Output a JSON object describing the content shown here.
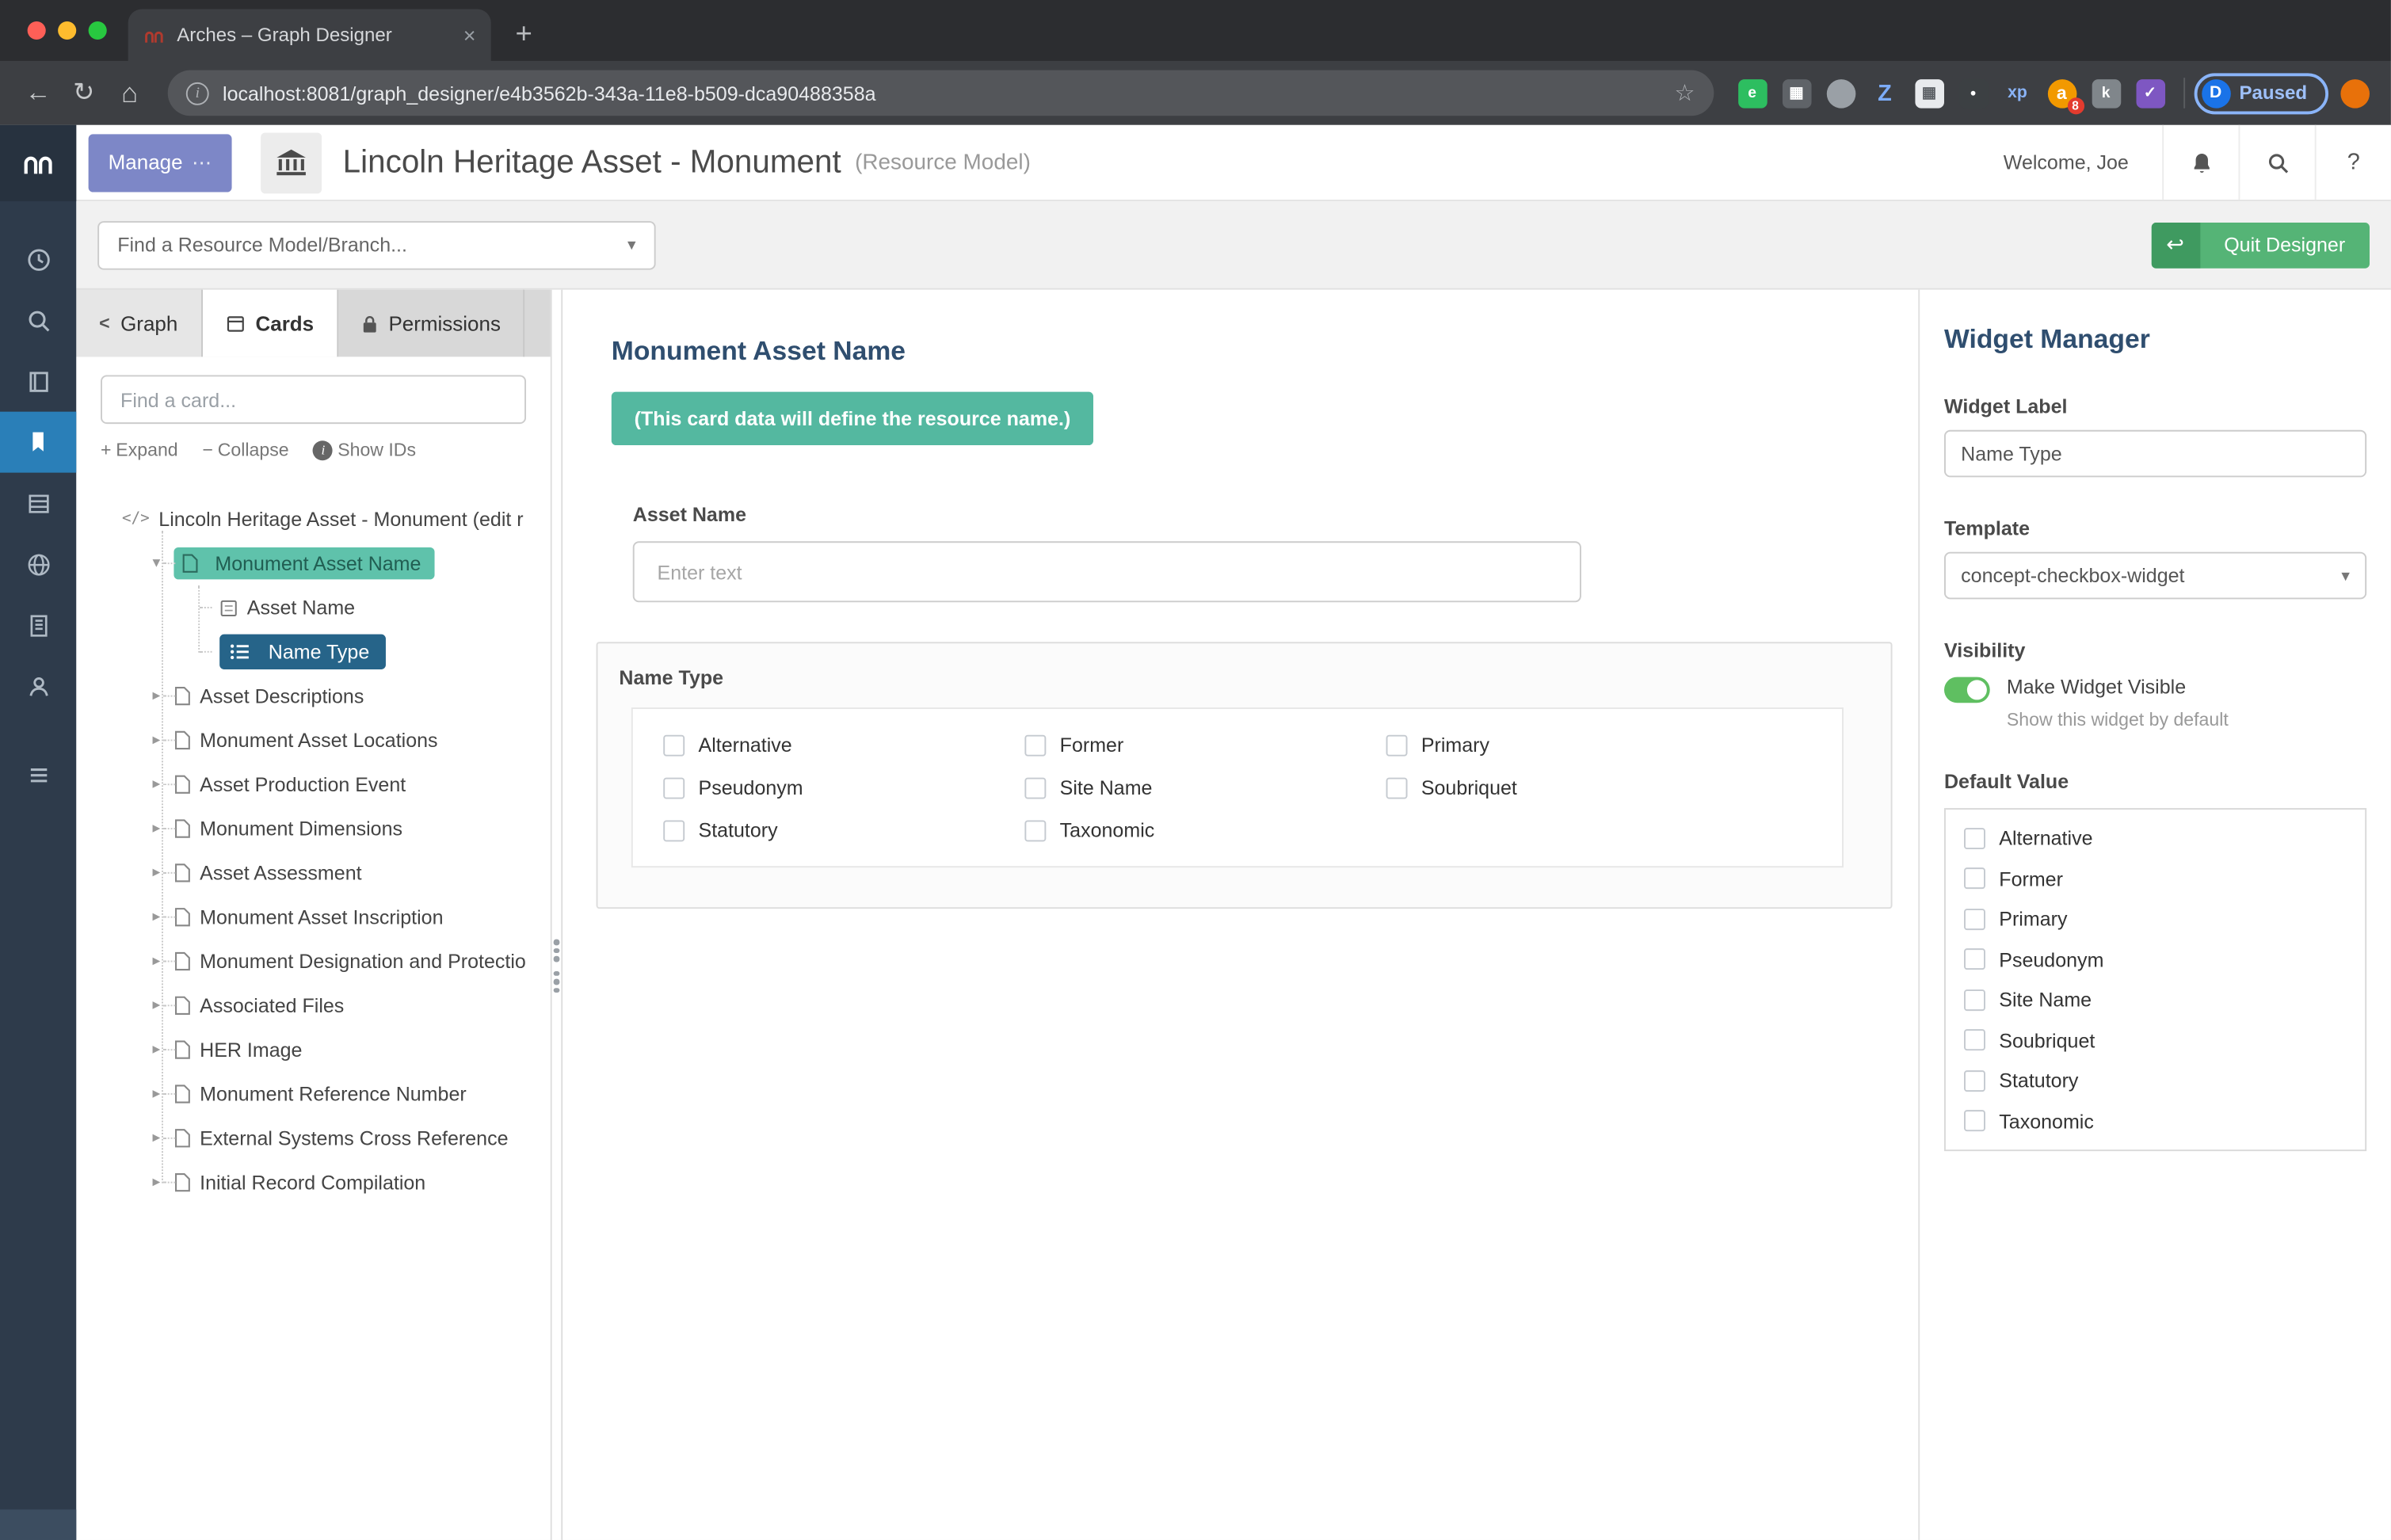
{
  "chrome": {
    "tab_title": "Arches – Graph Designer",
    "url": "localhost:8081/graph_designer/e4b3562b-343a-11e8-b509-dca90488358a",
    "profile_initial": "D",
    "profile_status": "Paused",
    "extension_badge": "8",
    "glyphs": {
      "back": "←",
      "refresh": "↻",
      "home": "⌂",
      "info": "i",
      "star": "☆",
      "new_tab": "+",
      "close_tab": "×"
    },
    "ext_glyphs": [
      "e",
      "▦",
      "●",
      "Z",
      "▦",
      "●",
      "xp",
      "a",
      "k",
      "✓"
    ]
  },
  "app": {
    "glyphs": {
      "caret": "▾",
      "collapsed": "▸",
      "expanded": "▾",
      "code": "</>",
      "plus": "+",
      "minus": "−",
      "chevron": "<",
      "help": "?",
      "return": "↩",
      "info": "i",
      "manage_dots": "⋯"
    },
    "header": {
      "manage": "Manage",
      "title": "Lincoln Heritage Asset - Monument",
      "subtitle": "(Resource Model)",
      "welcome": "Welcome, Joe"
    },
    "toolbar": {
      "find_placeholder": "Find a Resource Model/Branch...",
      "quit": "Quit Designer"
    },
    "tabs": {
      "graph": "Graph",
      "cards": "Cards",
      "permissions": "Permissions"
    },
    "cards_panel": {
      "search_placeholder": "Find a card...",
      "expand": "Expand",
      "collapse": "Collapse",
      "show_ids": "Show IDs",
      "tree": {
        "root": "Lincoln Heritage Asset - Monument (edit r",
        "selected": "Monument Asset Name",
        "children": [
          "Asset Name",
          "Name Type"
        ],
        "cards": [
          "Asset Descriptions",
          "Monument Asset Locations",
          "Asset Production Event",
          "Monument Dimensions",
          "Asset Assessment",
          "Monument Asset Inscription",
          "Monument Designation and Protectio",
          "Associated Files",
          "HER Image",
          "Monument Reference Number",
          "External Systems Cross Reference",
          "Initial Record Compilation"
        ]
      }
    },
    "editor": {
      "title": "Monument Asset Name",
      "banner": "(This card data will define the resource name.)",
      "field_label": "Asset Name",
      "input_placeholder": "Enter text",
      "group_label": "Name Type",
      "options": [
        "Alternative",
        "Former",
        "Primary",
        "Pseudonym",
        "Site Name",
        "Soubriquet",
        "Statutory",
        "Taxonomic"
      ]
    },
    "widget": {
      "title": "Widget Manager",
      "label_label": "Widget Label",
      "label_value": "Name Type",
      "template_label": "Template",
      "template_value": "concept-checkbox-widget",
      "visibility_label": "Visibility",
      "visible_label": "Make Widget Visible",
      "visible_sub": "Show this widget by default",
      "default_label": "Default Value"
    },
    "colors": {
      "accent_teal": "#54b8a0",
      "selected_blue": "#266489",
      "active_nav": "#2a7fb8",
      "brand_purple": "#7d87c7",
      "quit_green": "#55b476",
      "sidebar": "#2e3b4b"
    }
  }
}
